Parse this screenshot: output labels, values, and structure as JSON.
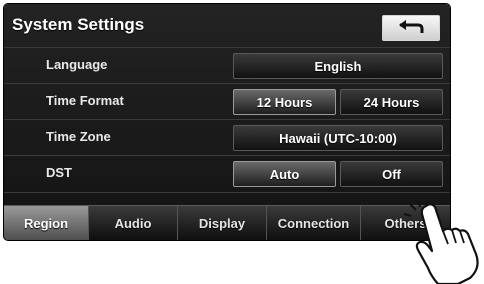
{
  "header": {
    "title": "System Settings",
    "back_icon": "return-arrow-icon"
  },
  "rows": [
    {
      "label": "Language",
      "options": [
        "English"
      ],
      "selected": "English"
    },
    {
      "label": "Time Format",
      "options": [
        "12 Hours",
        "24 Hours"
      ],
      "selected": "12 Hours"
    },
    {
      "label": "Time Zone",
      "options": [
        "Hawaii (UTC-10:00)"
      ],
      "selected": "Hawaii (UTC-10:00)"
    },
    {
      "label": "DST",
      "options": [
        "Auto",
        "Off"
      ],
      "selected": "Auto"
    }
  ],
  "tabs": [
    "Region",
    "Audio",
    "Display",
    "Connection",
    "Others"
  ],
  "active_tab": "Region",
  "pointer_icon": "pointing-hand-icon",
  "colors": {
    "background": "#1b1b1b",
    "text": "#ffffff",
    "selected_button": "#5a5a5a"
  }
}
